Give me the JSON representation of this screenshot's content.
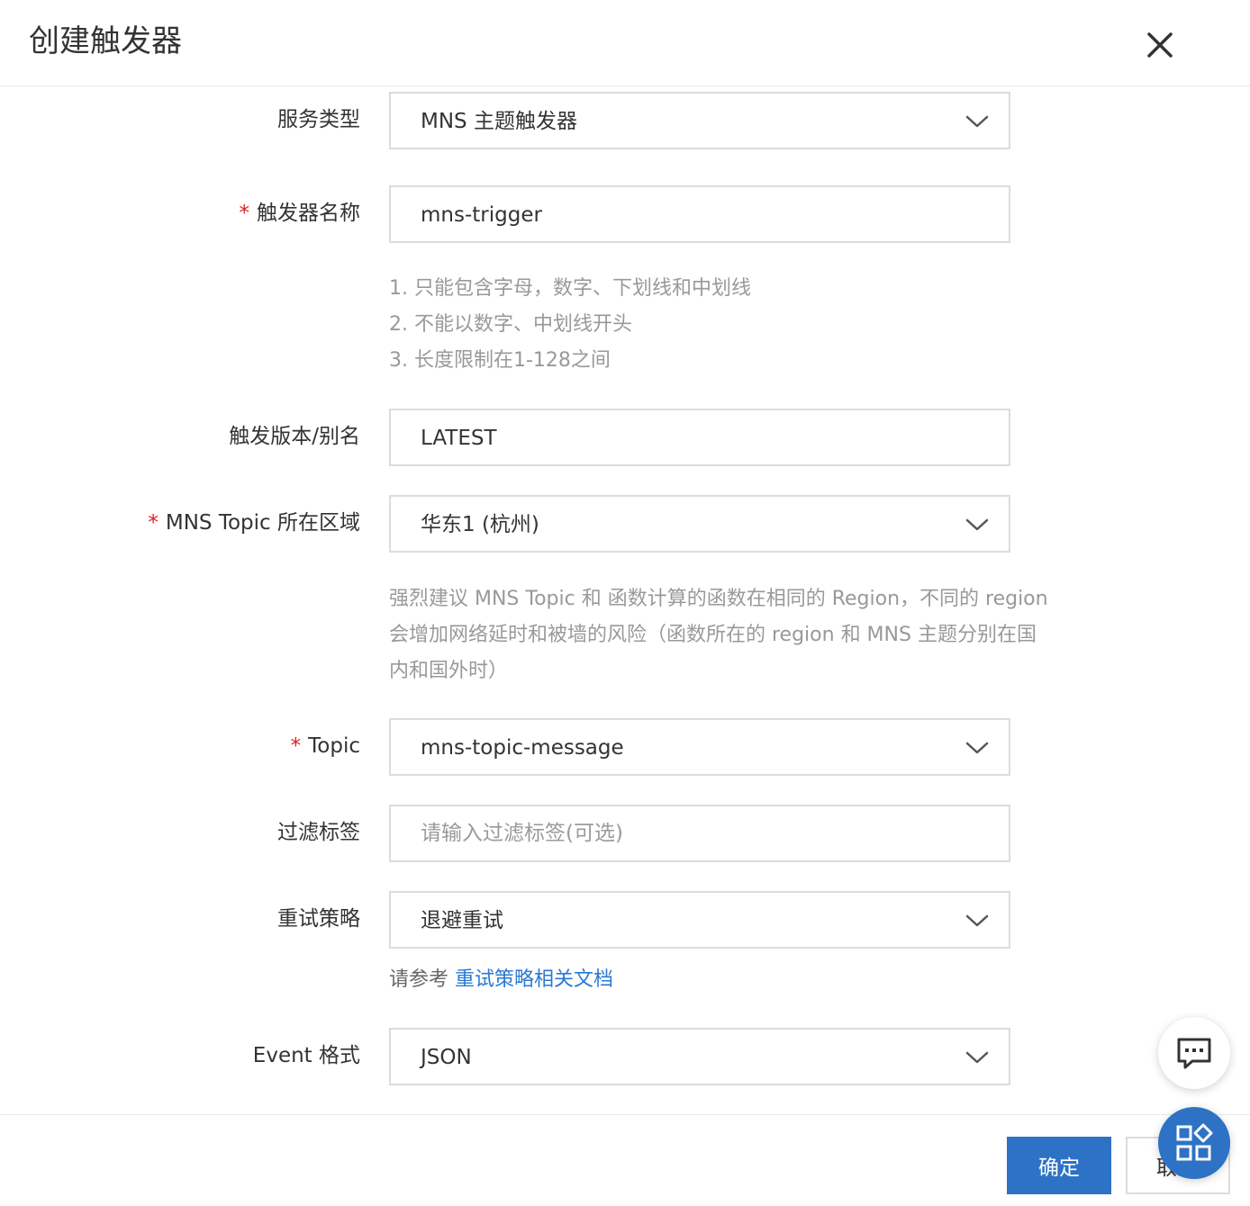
{
  "dialog": {
    "title": "创建触发器",
    "confirm_label": "确定",
    "cancel_label": "取消"
  },
  "form": {
    "service_type": {
      "label": "服务类型",
      "value": "MNS 主题触发器"
    },
    "trigger_name": {
      "label": "触发器名称",
      "value": "mns-trigger",
      "rules": [
        "1. 只能包含字母，数字、下划线和中划线",
        "2. 不能以数字、中划线开头",
        "3. 长度限制在1-128之间"
      ]
    },
    "version_alias": {
      "label": "触发版本/别名",
      "value": "LATEST"
    },
    "region": {
      "label": "MNS Topic 所在区域",
      "value": "华东1 (杭州)",
      "hint": [
        "强烈建议 MNS Topic 和 函数计算的函数在相同的 Region，不同的 region",
        "会增加网络延时和被墙的风险（函数所在的 region 和 MNS 主题分别在国",
        "内和国外时）"
      ]
    },
    "topic": {
      "label": "Topic",
      "value": "mns-topic-message"
    },
    "filter_tag": {
      "label": "过滤标签",
      "placeholder": "请输入过滤标签(可选)"
    },
    "retry_policy": {
      "label": "重试策略",
      "value": "退避重试",
      "doc_prefix": "请参考 ",
      "doc_link": "重试策略相关文档"
    },
    "event_format": {
      "label": "Event 格式",
      "value": "JSON"
    },
    "required_mark": "*"
  },
  "icons": {
    "close": "close-icon",
    "dropdown": "chevron-down-icon",
    "chat": "chat-icon",
    "apps": "apps-icon"
  },
  "colors": {
    "primary": "#2d72c4",
    "required": "#e02020",
    "link": "#2a7ad1",
    "hint": "#999999"
  }
}
